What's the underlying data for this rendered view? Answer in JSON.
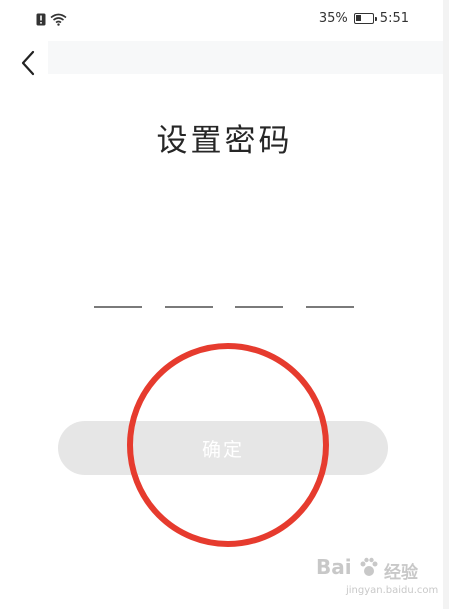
{
  "status_bar": {
    "battery_percent_text": "35%",
    "battery_level": 0.35,
    "time": "5:51",
    "left_icons": [
      "alert-icon",
      "wifi-icon"
    ]
  },
  "nav": {
    "back_icon": "chevron-left-icon"
  },
  "title": "设置密码",
  "pin": {
    "slot_count": 4
  },
  "confirm_button": {
    "label": "确定",
    "enabled": false
  },
  "watermark": {
    "line1": "Bai",
    "line2": "jingyan.baidu.com"
  },
  "colors": {
    "annotation": "#e63b2e",
    "button_bg": "#e6e6e6",
    "button_text": "#ffffff",
    "title_text": "#262626"
  }
}
